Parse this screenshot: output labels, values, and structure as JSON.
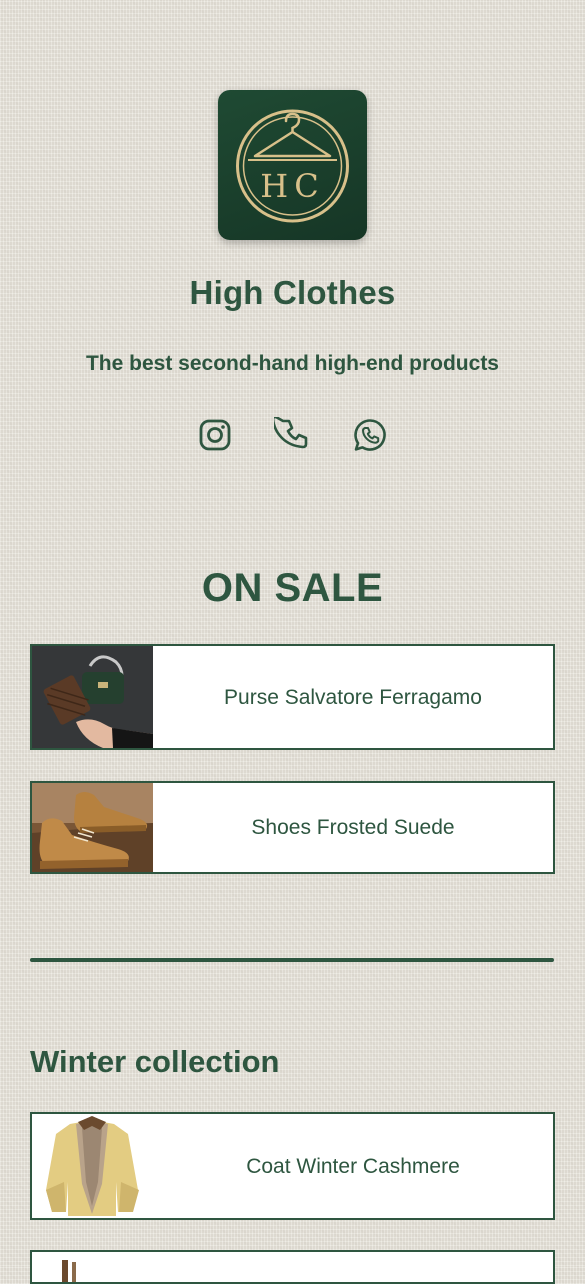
{
  "profile": {
    "logo_text": "HC",
    "name": "High Clothes",
    "tagline": "The best second-hand high-end products"
  },
  "social": [
    {
      "icon": "instagram-icon"
    },
    {
      "icon": "phone-icon"
    },
    {
      "icon": "whatsapp-icon"
    }
  ],
  "sections": {
    "on_sale": {
      "title": "ON SALE",
      "items": [
        {
          "title": "Purse Salvatore Ferragamo",
          "image": "purse-image"
        },
        {
          "title": "Shoes Frosted Suede",
          "image": "shoes-image"
        }
      ]
    },
    "winter": {
      "title": "Winter collection",
      "items": [
        {
          "title": "Coat Winter Cashmere",
          "image": "coat-image"
        },
        {
          "title": "",
          "image": "partial-item-image"
        }
      ]
    }
  },
  "colors": {
    "brand_green": "#2e5640",
    "logo_bg": "#1f4a33",
    "logo_gold": "#d8c08a",
    "background": "#e9e5dc"
  }
}
